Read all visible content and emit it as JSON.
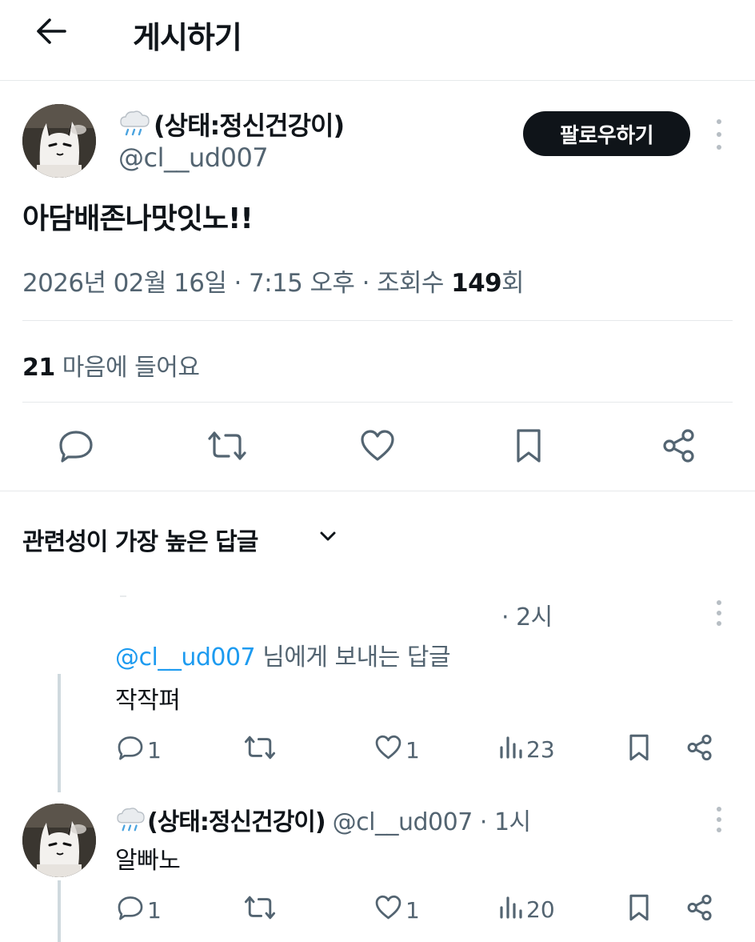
{
  "header": {
    "title": "게시하기"
  },
  "post": {
    "author_name": "(상태:정신건강이)",
    "author_handle": "@cl__ud007",
    "follow_label": "팔로우하기",
    "text": "아담배존나맛잇노!!",
    "meta_prefix": "2026년 02월 16일 · 7:15 오후 · 조회수 ",
    "views": "149",
    "views_suffix": "회",
    "likes_count": "21",
    "likes_label": " 마음에 들어요"
  },
  "sort": {
    "label": "관련성이 가장 높은 답글"
  },
  "replies": [
    {
      "time": "· 2시",
      "reply_to_handle": "@cl__ud007",
      "reply_to_suffix": " 님에게 보내는 답글",
      "text": "작작펴",
      "replies_count": "1",
      "likes_count": "1",
      "views_count": "23"
    },
    {
      "author_name": "(상태:정신건강이)",
      "author_handle": "@cl__ud007",
      "time": "· 1시",
      "text": "알빠노",
      "replies_count": "1",
      "likes_count": "1",
      "views_count": "20"
    }
  ],
  "icons": {
    "back": "arrow-left-icon",
    "status_emoji": "rain-cloud-icon",
    "reply": "speech-bubble-icon",
    "repost": "repost-icon",
    "like": "heart-icon",
    "bookmark": "bookmark-icon",
    "share": "share-icon",
    "views": "bar-chart-icon",
    "more": "kebab-icon"
  },
  "colors": {
    "link": "#1d9bf0",
    "text": "#0f1419",
    "muted": "#536471",
    "follow_bg": "#0f1419"
  }
}
